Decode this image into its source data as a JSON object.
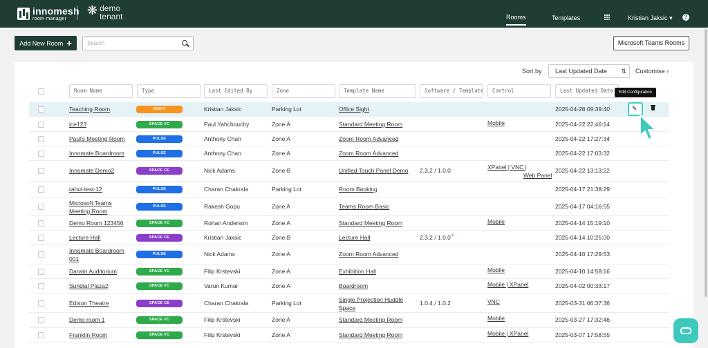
{
  "nav": {
    "brand_name": "innomesh",
    "brand_sub": "room manager",
    "tenant_line1": "demo",
    "tenant_line2": "tenant",
    "links": [
      "Rooms",
      "Templates"
    ],
    "user": "Kristian Jaksic ▾",
    "help": "?"
  },
  "toolbar": {
    "add_label": "Add New Room",
    "add_icon": "+",
    "search_placeholder": "Search",
    "teams_label": "Microsoft Teams Rooms"
  },
  "sort": {
    "label": "Sort by",
    "value": "Last Updated Date",
    "dir_icon": "⇅",
    "customise": "Customise ›"
  },
  "columns": [
    "Room Name",
    "Type",
    "Last Edited By",
    "Zone",
    "Template Name",
    "Software / Template",
    "Control",
    "Last Updated Date"
  ],
  "tooltip": "Edit Configuration",
  "edit_icon": "✎",
  "colors": {
    "sight": "#f7931e",
    "space_vc": "#2eaa4a",
    "pulse": "#1f6fe6",
    "space_ce": "#8b3ec8",
    "nav_bg": "#1f3d34",
    "accent": "#39d1c2"
  },
  "rows": [
    {
      "room": "Teaching Room",
      "type": "SIGHT",
      "type_color": "#f7931e",
      "editor": "Kristian Jaksic",
      "zone": "Parking Lot",
      "template": "Office Sight",
      "software": "",
      "control": "",
      "updated": "2025-04-28 09:39:40"
    },
    {
      "room": "ice123",
      "type": "SPACE VC",
      "type_color": "#2eaa4a",
      "editor": "Paul Yahchouchy",
      "zone": "Zone A",
      "template": "Standard Meeting Room",
      "software": "",
      "control": "Mobile",
      "updated": "2025-04-22 22:46:14"
    },
    {
      "room": "Paul's Meeting Room",
      "type": "PULSE",
      "type_color": "#1f6fe6",
      "editor": "Anthony Chan",
      "zone": "Zone A",
      "template": "Zoom Room Advanced",
      "software": "",
      "control": "",
      "updated": "2025-04-22 17:27:34"
    },
    {
      "room": "Innomate Boardroom",
      "type": "PULSE",
      "type_color": "#1f6fe6",
      "editor": "Anthony Chan",
      "zone": "Zone A",
      "template": "Zoom Room Advanced",
      "software": "",
      "control": "",
      "updated": "2025-04-22 17:03:32"
    },
    {
      "room": "Innomate Demo2",
      "type": "SPACE CE",
      "type_color": "#8b3ec8",
      "editor": "Nick Adams",
      "zone": "Zone B",
      "template": "Unified Touch Panel Demo",
      "software": "2.3.2 / 1.0.0",
      "control": "XPanel | VNC |",
      "control2": "Web Panel",
      "updated": "2025-04-22 13:13:22"
    },
    {
      "room": "rahul-test-12",
      "type": "PULSE",
      "type_color": "#1f6fe6",
      "editor": "Charan Chakrala",
      "zone": "Parking Lot",
      "template": "Room Booking",
      "software": "",
      "control": "",
      "updated": "2025-04-17 21:38:29"
    },
    {
      "room": "Microsoft Teams",
      "room2": "Meeting Room",
      "type": "PULSE",
      "type_color": "#1f6fe6",
      "editor": "Rakesh Gopu",
      "zone": "Zone A",
      "template": "Teams Room Basic",
      "software": "",
      "control": "",
      "updated": "2025-04-17 04:16:55"
    },
    {
      "room": "Demo Room 123456",
      "type": "SPACE VC",
      "type_color": "#2eaa4a",
      "editor": "Rohan Anderson",
      "zone": "Zone A",
      "template": "Standard Meeting Room",
      "software": "",
      "control": "Mobile",
      "updated": "2025-04-14 15:19:10"
    },
    {
      "room": "Lecture Hall",
      "type": "SPACE CE",
      "type_color": "#8b3ec8",
      "editor": "Kristian Jaksic",
      "zone": "Zone B",
      "template": "Lecture Hall",
      "software": "2.3.2 / 1.0.0",
      "software_mark": "*",
      "control": "",
      "updated": "2025-04-14 10:25:00"
    },
    {
      "room": "Innomate Boardroom",
      "room2": "001",
      "type": "PULSE",
      "type_color": "#1f6fe6",
      "editor": "Nick Adams",
      "zone": "Zone A",
      "template": "Zoom Room Advanced",
      "software": "",
      "control": "",
      "updated": "2025-04-10 17:29:53"
    },
    {
      "room": "Darwin Auditorium",
      "type": "SPACE VC",
      "type_color": "#2eaa4a",
      "editor": "Filip Krstevski",
      "zone": "Zone A",
      "template": "Exhibition Hall",
      "software": "",
      "control": "Mobile",
      "updated": "2025-04-10 14:58:16"
    },
    {
      "room": "Sundial Plaza2",
      "type": "SPACE VC",
      "type_color": "#2eaa4a",
      "editor": "Varun Kumar",
      "zone": "Zone A",
      "template": "Boardroom",
      "software": "",
      "control": "Mobile | XPanel",
      "updated": "2025-04-02 00:33:17"
    },
    {
      "room": "Edison Theatre",
      "type": "SPACE CE",
      "type_color": "#8b3ec8",
      "editor": "Charan Chakrala",
      "zone": "Parking Lot",
      "template": "Single Projection Huddle",
      "template2": "Space",
      "software": "1.0.4 / 1.0.2",
      "control": "VNC",
      "updated": "2025-03-31 06:37:36"
    },
    {
      "room": "Demo room 1",
      "type": "SPACE VC",
      "type_color": "#2eaa4a",
      "editor": "Filip Krstevski",
      "zone": "Zone A",
      "template": "Standard Meeting Room",
      "software": "",
      "control": "Mobile",
      "updated": "2025-03-27 17:32:46"
    },
    {
      "room": "Franklin Room",
      "type": "SPACE VC",
      "type_color": "#2eaa4a",
      "editor": "Filip Krstevski",
      "zone": "Zone A",
      "template": "Standard Meeting Room",
      "software": "",
      "control": "Mobile | XPanel",
      "updated": "2025-03-07 17:58:55"
    }
  ]
}
